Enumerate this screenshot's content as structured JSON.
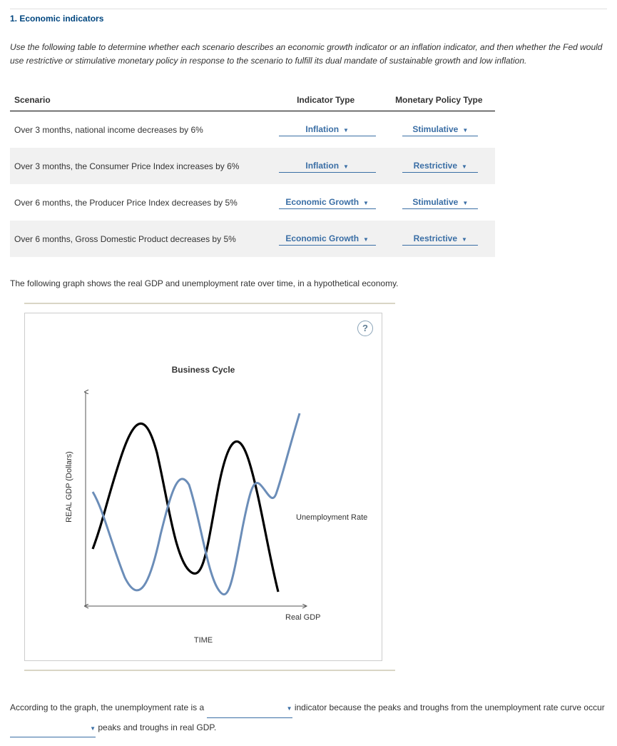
{
  "section_title": "1. Economic indicators",
  "instructions": "Use the following table to determine whether each scenario describes an economic growth indicator or an inflation indicator, and then whether the Fed would use restrictive or stimulative monetary policy in response to the scenario to fulfill its dual mandate of sustainable growth and low inflation.",
  "table": {
    "headers": {
      "scenario": "Scenario",
      "indicator": "Indicator Type",
      "policy": "Monetary Policy Type"
    },
    "rows": [
      {
        "scenario": "Over 3 months, national income decreases by 6%",
        "indicator": "Inflation",
        "policy": "Stimulative"
      },
      {
        "scenario": "Over 3 months, the Consumer Price Index increases by 6%",
        "indicator": "Inflation",
        "policy": "Restrictive"
      },
      {
        "scenario": "Over 6 months, the Producer Price Index decreases by 5%",
        "indicator": "Economic Growth",
        "policy": "Stimulative"
      },
      {
        "scenario": "Over 6 months, Gross Domestic Product decreases by 5%",
        "indicator": "Economic Growth",
        "policy": "Restrictive"
      }
    ]
  },
  "graph_intro": "The following graph shows the real GDP and unemployment rate over time, in a hypothetical economy.",
  "chart": {
    "title": "Business Cycle",
    "ylabel": "REAL GDP (Dollars)",
    "xlabel": "TIME",
    "series_labels": {
      "unemployment": "Unemployment Rate",
      "real_gdp": "Real GDP"
    },
    "help": "?"
  },
  "chart_data": {
    "type": "line",
    "xlabel": "TIME",
    "ylabel": "REAL GDP (Dollars)",
    "title": "Business Cycle",
    "series": [
      {
        "name": "Real GDP",
        "color": "#000000",
        "x": [
          0,
          0.5,
          1,
          1.5,
          2,
          2.5,
          3,
          3.5,
          4,
          4.5,
          5,
          5.5,
          6,
          6.5
        ],
        "y": [
          2.0,
          3.2,
          5.5,
          7.8,
          6.0,
          3.0,
          1.2,
          2.5,
          5.5,
          7.5,
          6.0,
          4.0,
          2.0,
          1.0
        ]
      },
      {
        "name": "Unemployment Rate",
        "color": "#6b8db8",
        "x": [
          0,
          0.5,
          1,
          1.5,
          2,
          2.5,
          3,
          3.5,
          4,
          4.5,
          5,
          5.5,
          6,
          6.5,
          7,
          7.5
        ],
        "y": [
          4.5,
          3.5,
          2.0,
          0.5,
          1.5,
          3.5,
          5.0,
          3.8,
          2.0,
          0.8,
          2.0,
          3.8,
          4.8,
          4.0,
          5.0,
          7.5
        ]
      }
    ],
    "xlim": [
      0,
      8
    ],
    "ylim": [
      0,
      8
    ]
  },
  "fill_sentence": {
    "part1": "According to the graph, the unemployment rate is a",
    "part2": "indicator because the peaks and troughs from the unemployment rate curve occur",
    "part3": "peaks and troughs in real GDP."
  }
}
